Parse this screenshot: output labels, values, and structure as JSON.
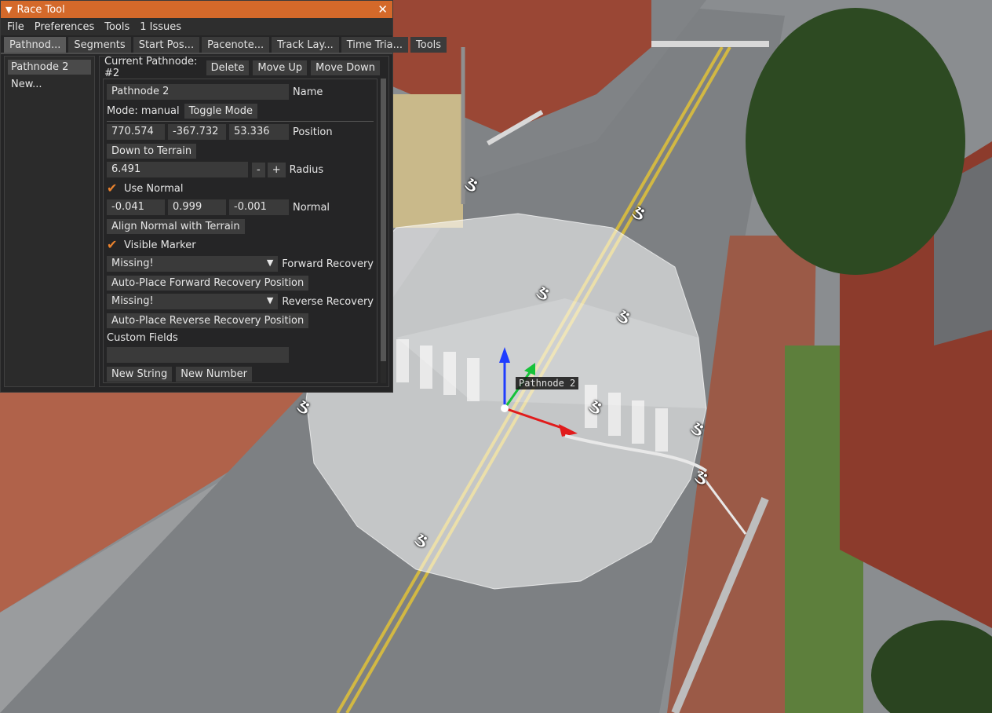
{
  "window": {
    "title": "Race Tool",
    "close_glyph": "✕",
    "collapse_glyph": "▼"
  },
  "menu": [
    "File",
    "Preferences",
    "Tools",
    "1 Issues"
  ],
  "tabs": [
    "Pathnod...",
    "Segments",
    "Start Pos...",
    "Pacenote...",
    "Track Lay...",
    "Time Tria...",
    "Tools"
  ],
  "list": {
    "items": [
      "Pathnode 2",
      "New..."
    ]
  },
  "editor": {
    "current_label": "Current Pathnode: #2",
    "delete": "Delete",
    "move_up": "Move Up",
    "move_down": "Move Down",
    "name_value": "Pathnode 2",
    "name_label": "Name",
    "mode_text": "Mode: manual",
    "toggle_mode": "Toggle Mode",
    "position": {
      "x": "770.574",
      "y": "-367.732",
      "z": "53.336",
      "label": "Position"
    },
    "down_to_terrain": "Down to Terrain",
    "radius": {
      "value": "6.491",
      "minus": "-",
      "plus": "+",
      "label": "Radius"
    },
    "use_normal": {
      "checked": true,
      "label": "Use Normal"
    },
    "normal": {
      "x": "-0.041",
      "y": "0.999",
      "z": "-0.001",
      "label": "Normal"
    },
    "align_normal": "Align Normal with Terrain",
    "visible_marker": {
      "checked": true,
      "label": "Visible Marker"
    },
    "forward_recovery": {
      "value": "Missing!",
      "label": "Forward Recovery"
    },
    "auto_forward": "Auto-Place Forward Recovery Position",
    "reverse_recovery": {
      "value": "Missing!",
      "label": "Reverse Recovery"
    },
    "auto_reverse": "Auto-Place Reverse Recovery Position",
    "custom_fields_label": "Custom Fields",
    "custom_field_value": "",
    "new_string": "New String",
    "new_number": "New Number"
  },
  "viewport": {
    "node_label": "Pathnode 2",
    "colors": {
      "accent": "#d4692a",
      "road": "#7d8083",
      "brick": "#a85a44",
      "grass": "#4f7a33"
    }
  }
}
